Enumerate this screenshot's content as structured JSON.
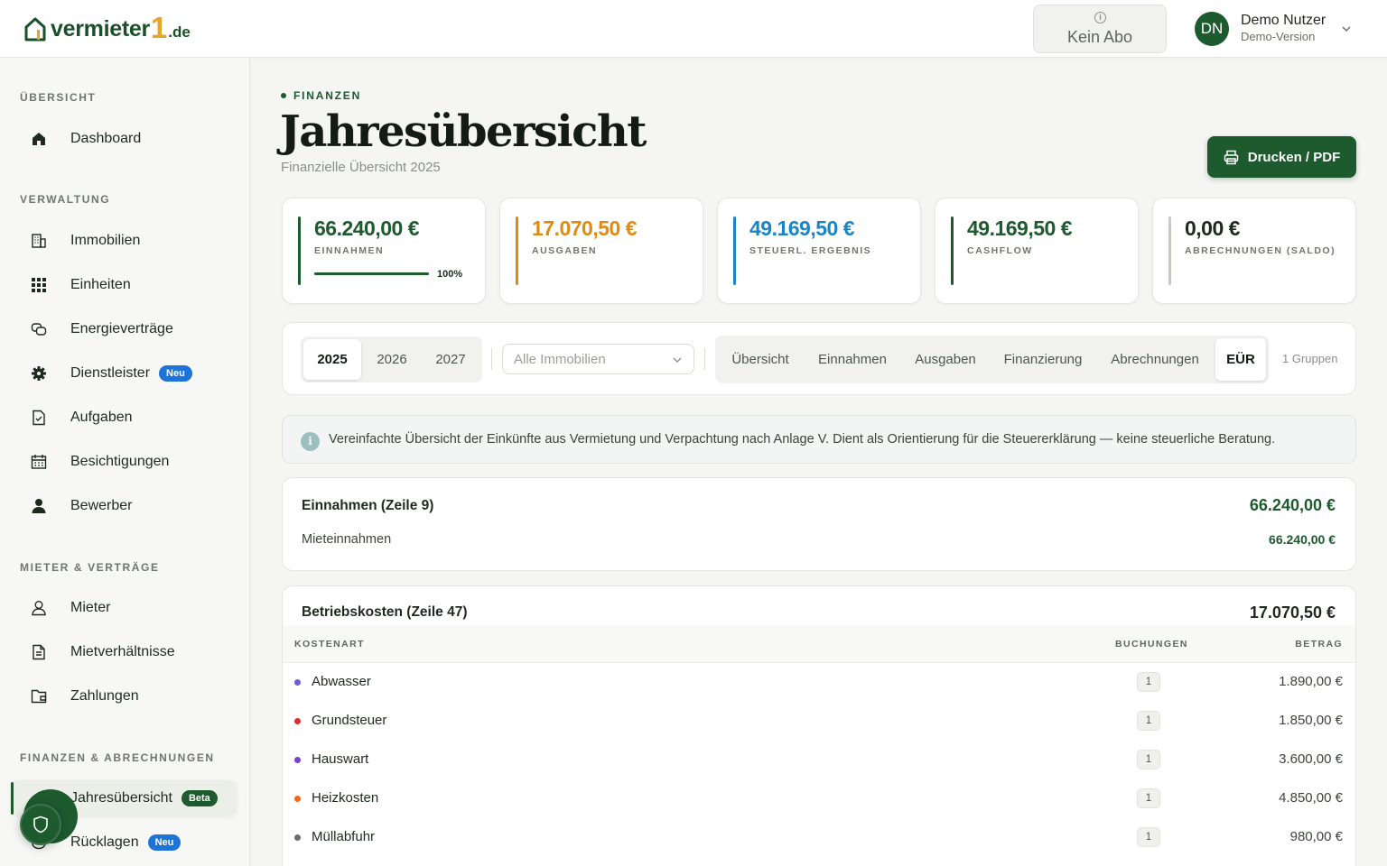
{
  "header": {
    "logo_text": "vermieter",
    "logo_number": "1",
    "logo_tld": ".de",
    "subscription_label": "Kein Abo",
    "user_initials": "DN",
    "user_name": "Demo Nutzer",
    "user_subtitle": "Demo-Version"
  },
  "sidebar": {
    "sections": [
      {
        "title": "ÜBERSICHT",
        "items": [
          {
            "label": "Dashboard",
            "icon": "home-icon"
          }
        ]
      },
      {
        "title": "VERWALTUNG",
        "items": [
          {
            "label": "Immobilien",
            "icon": "building-icon"
          },
          {
            "label": "Einheiten",
            "icon": "grid-icon"
          },
          {
            "label": "Energieverträge",
            "icon": "energy-contract-icon"
          },
          {
            "label": "Dienstleister",
            "icon": "gear-icon",
            "badge": "Neu"
          },
          {
            "label": "Aufgaben",
            "icon": "task-check-icon"
          },
          {
            "label": "Besichtigungen",
            "icon": "calendar-icon"
          },
          {
            "label": "Bewerber",
            "icon": "person-filled-icon"
          }
        ]
      },
      {
        "title": "MIETER & VERTRÄGE",
        "items": [
          {
            "label": "Mieter",
            "icon": "person-icon"
          },
          {
            "label": "Mietverhältnisse",
            "icon": "document-icon"
          },
          {
            "label": "Zahlungen",
            "icon": "wallet-icon"
          }
        ]
      },
      {
        "title": "FINANZEN & ABRECHNUNGEN",
        "items": [
          {
            "label": "Jahresübersicht",
            "icon": "chart-icon",
            "badge": "Beta",
            "active": true
          },
          {
            "label": "Rücklagen",
            "icon": "piggy-bank-icon",
            "badge": "Neu"
          }
        ]
      }
    ]
  },
  "page": {
    "eyebrow": "FINANZEN",
    "title": "Jahresübersicht",
    "subtitle": "Finanzielle Übersicht 2025",
    "print_button": "Drucken / PDF"
  },
  "stats": [
    {
      "value": "66.240,00 €",
      "label": "EINNAHMEN",
      "color": "#1d5a2e",
      "progress_label": "100%",
      "progress": 1.0
    },
    {
      "value": "17.070,50 €",
      "label": "AUSGABEN",
      "color": "#e08a12"
    },
    {
      "value": "49.169,50 €",
      "label": "STEUERL. ERGEBNIS",
      "color": "#1b86c6"
    },
    {
      "value": "49.169,50 €",
      "label": "CASHFLOW",
      "color": "#1d5a2e"
    },
    {
      "value": "0,00 €",
      "label": "ABRECHNUNGEN (SALDO)",
      "color": "#1f2a1f",
      "bar_color": "#c9c9c4"
    }
  ],
  "filters": {
    "years": [
      "2025",
      "2026",
      "2027"
    ],
    "selected_year": "2025",
    "property_select_placeholder": "Alle Immobilien",
    "tabs": [
      "Übersicht",
      "Einnahmen",
      "Ausgaben",
      "Finanzierung",
      "Abrechnungen",
      "EÜR"
    ],
    "active_tab": "EÜR",
    "group_count": "1 Gruppen"
  },
  "notice": "Vereinfachte Übersicht der Einkünfte aus Vermietung und Verpachtung nach Anlage V. Dient als Orientierung für die Steuererklärung — keine steuerliche Beratung.",
  "income": {
    "title": "Einnahmen (Zeile 9)",
    "total": "66.240,00 €",
    "lines": [
      {
        "label": "Mieteinnahmen",
        "value": "66.240,00 €"
      }
    ]
  },
  "operating_costs": {
    "title": "Betriebskosten (Zeile 47)",
    "total": "17.070,50 €",
    "columns": [
      "KOSTENART",
      "BUCHUNGEN",
      "BETRAG"
    ],
    "rows": [
      {
        "name": "Abwasser",
        "count": "1",
        "amount": "1.890,00 €",
        "color": "#6a5fd8"
      },
      {
        "name": "Grundsteuer",
        "count": "1",
        "amount": "1.850,00 €",
        "color": "#d62f2f"
      },
      {
        "name": "Hauswart",
        "count": "1",
        "amount": "3.600,00 €",
        "color": "#7a3fd8"
      },
      {
        "name": "Heizkosten",
        "count": "1",
        "amount": "4.850,00 €",
        "color": "#ea6a1a"
      },
      {
        "name": "Müllabfuhr",
        "count": "1",
        "amount": "980,00 €",
        "color": "#6b6b6b"
      }
    ]
  }
}
